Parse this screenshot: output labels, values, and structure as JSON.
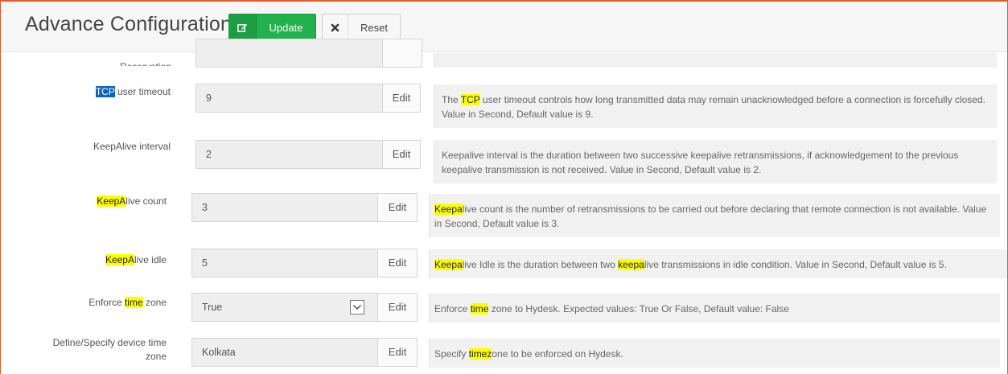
{
  "header": {
    "title": "Advance Configurations",
    "update_label": "Update",
    "reset_label": "Reset"
  },
  "partial_row": {
    "label": "Reservation"
  },
  "rows": [
    {
      "label_sel": "TCP",
      "label_rest": " user timeout",
      "value": "9",
      "edit_label": "Edit",
      "desc_1": "The ",
      "desc_hl": "TCP",
      "desc_2": " user timeout controls how long transmitted data may remain unacknowledged before a connection is forcefully closed. Value in Second, Default value is 9."
    },
    {
      "label": "KeepAlive interval",
      "value": "2",
      "edit_label": "Edit",
      "desc": "Keepalive interval is the duration between two successive keepalive retransmissions, if acknowledgement to the previous keepalive transmission is not received. Value in Second, Default value is 2."
    },
    {
      "label_hl": "KeepA",
      "label_rest": "live count",
      "value": "3",
      "edit_label": "Edit",
      "desc_hl": "Keepa",
      "desc_rest": "live count is the number of retransmissions to be carried out before declaring that remote connection is not available. Value in Second, Default value is 3."
    },
    {
      "label_hl": "KeepA",
      "label_rest": "live idle",
      "value": "5",
      "edit_label": "Edit",
      "desc_hl1": "Keepa",
      "desc_mid": "live Idle is the duration between two ",
      "desc_hl2": "keepa",
      "desc_end": "live transmissions in idle condition. Value in Second, Default value is 5."
    },
    {
      "label_1": "Enforce ",
      "label_hl": "time",
      "label_2": " zone",
      "value": "True",
      "edit_label": "Edit",
      "desc_1": "Enforce ",
      "desc_hl": "time",
      "desc_2": " zone to Hydesk. Expected values: True Or False, Default value: False"
    },
    {
      "label_line1": "Define/Specify device time",
      "label_line2": "zone",
      "value": "Kolkata",
      "edit_label": "Edit",
      "desc_1": "Specify ",
      "desc_hl": "timez",
      "desc_2": "one to be enforced on Hydesk."
    }
  ]
}
